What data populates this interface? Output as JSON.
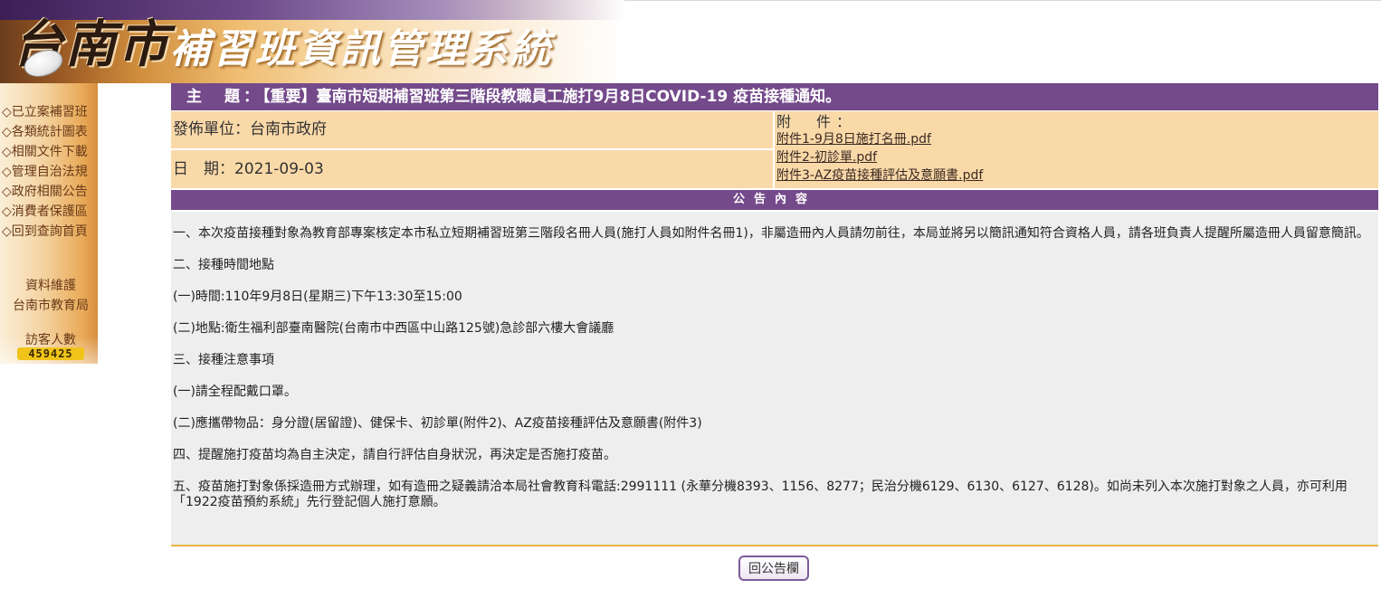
{
  "banner": {
    "city_logo": "台南市",
    "system_title": "補習班資訊管理系統"
  },
  "sidebar": {
    "items": [
      {
        "label": "◇已立案補習班"
      },
      {
        "label": "◇各類統計圖表"
      },
      {
        "label": "◇相關文件下載"
      },
      {
        "label": "◇管理自治法規"
      },
      {
        "label": "◇政府相關公告"
      },
      {
        "label": "◇消費者保護區"
      },
      {
        "label": "◇回到查詢首頁"
      }
    ],
    "maintenance_title": "資料維護",
    "maintenance_org": "台南市教育局",
    "visitor_label": "訪客人數",
    "visitor_count": "459425"
  },
  "announcement": {
    "subject_label": "主　題：",
    "subject": "【重要】臺南市短期補習班第三階段教職員工施打9月8日COVID-19 疫苗接種通知。",
    "publisher_label": "發佈單位：",
    "publisher": "台南市政府",
    "date_label": "日　期：",
    "date": "2021-09-03",
    "attachments_label": "附　件：",
    "attachments": [
      {
        "name": "附件1-9月8日施打名冊.pdf"
      },
      {
        "name": "附件2-初診單.pdf"
      },
      {
        "name": "附件3-AZ疫苗接種評估及意願書.pdf"
      }
    ],
    "content_header": "公告內容",
    "content_paragraphs": [
      "一、本次疫苗接種對象為教育部專案核定本市私立短期補習班第三階段名冊人員(施打人員如附件名冊1)，非屬造冊內人員請勿前往，本局並將另以簡訊通知符合資格人員，請各班負責人提醒所屬造冊人員留意簡訊。",
      "二、接種時間地點",
      "(一)時間:110年9月8日(星期三)下午13:30至15:00",
      "(二)地點:衛生福利部臺南醫院(台南市中西區中山路125號)急診部六樓大會議廳",
      "三、接種注意事項",
      "(一)請全程配戴口罩。",
      "(二)應攜帶物品：身分證(居留證)、健保卡、初診單(附件2)、AZ疫苗接種評估及意願書(附件3)",
      "四、提醒施打疫苗均為自主決定，請自行評估自身狀況，再決定是否施打疫苗。",
      "五、疫苗施打對象係採造冊方式辦理，如有造冊之疑義請洽本局社會教育科電話:2991111 (永華分機8393、1156、8277；民治分機6129、6130、6127、6128)。如尚未列入本次施打對象之人員，亦可利用「1922疫苗預約系統」先行登記個人施打意願。"
    ],
    "back_button": "回公告欄"
  },
  "colors": {
    "header_purple": "#744a8b",
    "info_peach": "#fad9a9",
    "body_gray": "#eeeeee",
    "visitor_yellow": "#f0c419"
  },
  "icons": [
    "computer-mouse-icon"
  ]
}
